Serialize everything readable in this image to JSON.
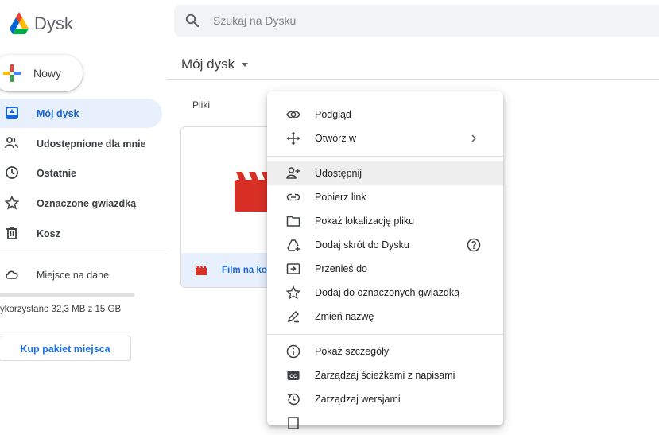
{
  "app": {
    "title": "Dysk"
  },
  "search": {
    "placeholder": "Szukaj na Dysku"
  },
  "new_button": {
    "label": "Nowy"
  },
  "sidebar": {
    "items": [
      {
        "label": "Mój dysk",
        "icon": "my-drive-icon",
        "active": true
      },
      {
        "label": "Udostępnione dla mnie",
        "icon": "shared-icon"
      },
      {
        "label": "Ostatnie",
        "icon": "clock-icon"
      },
      {
        "label": "Oznaczone gwiazdką",
        "icon": "star-icon"
      },
      {
        "label": "Kosz",
        "icon": "trash-icon"
      }
    ],
    "storage": {
      "label": "Miejsce na dane",
      "usage_text": "ykorzystano 32,3 MB z 15 GB",
      "used_fraction": 0.002
    },
    "buy_button": "Kup pakiet miejsca"
  },
  "main": {
    "title": "Mój dysk",
    "section": "Pliki",
    "file": {
      "name": "Film na ko"
    }
  },
  "context_menu": {
    "items": [
      {
        "label": "Podgląd",
        "icon": "eye-icon"
      },
      {
        "label": "Otwórz w",
        "icon": "move-arrows-icon",
        "has_submenu": true
      },
      {
        "label": "Udostępnij",
        "icon": "add-person-icon",
        "highlighted": true
      },
      {
        "label": "Pobierz link",
        "icon": "link-icon"
      },
      {
        "label": "Pokaż lokalizację pliku",
        "icon": "folder-icon"
      },
      {
        "label": "Dodaj skrót do Dysku",
        "icon": "add-shortcut-icon",
        "help": true
      },
      {
        "label": "Przenieś do",
        "icon": "move-folder-icon"
      },
      {
        "label": "Dodaj do oznaczonych gwiazdką",
        "icon": "star-outline-icon"
      },
      {
        "label": "Zmień nazwę",
        "icon": "pencil-icon"
      },
      {
        "label": "Pokaż szczegóły",
        "icon": "info-icon"
      },
      {
        "label": "Zarządzaj ścieżkami z napisami",
        "icon": "captions-icon"
      },
      {
        "label": "Zarządzaj wersjami",
        "icon": "history-icon"
      }
    ]
  },
  "colors": {
    "accent": "#1a73e8",
    "active_bg": "#e8f0fe",
    "video_red": "#d93025"
  }
}
